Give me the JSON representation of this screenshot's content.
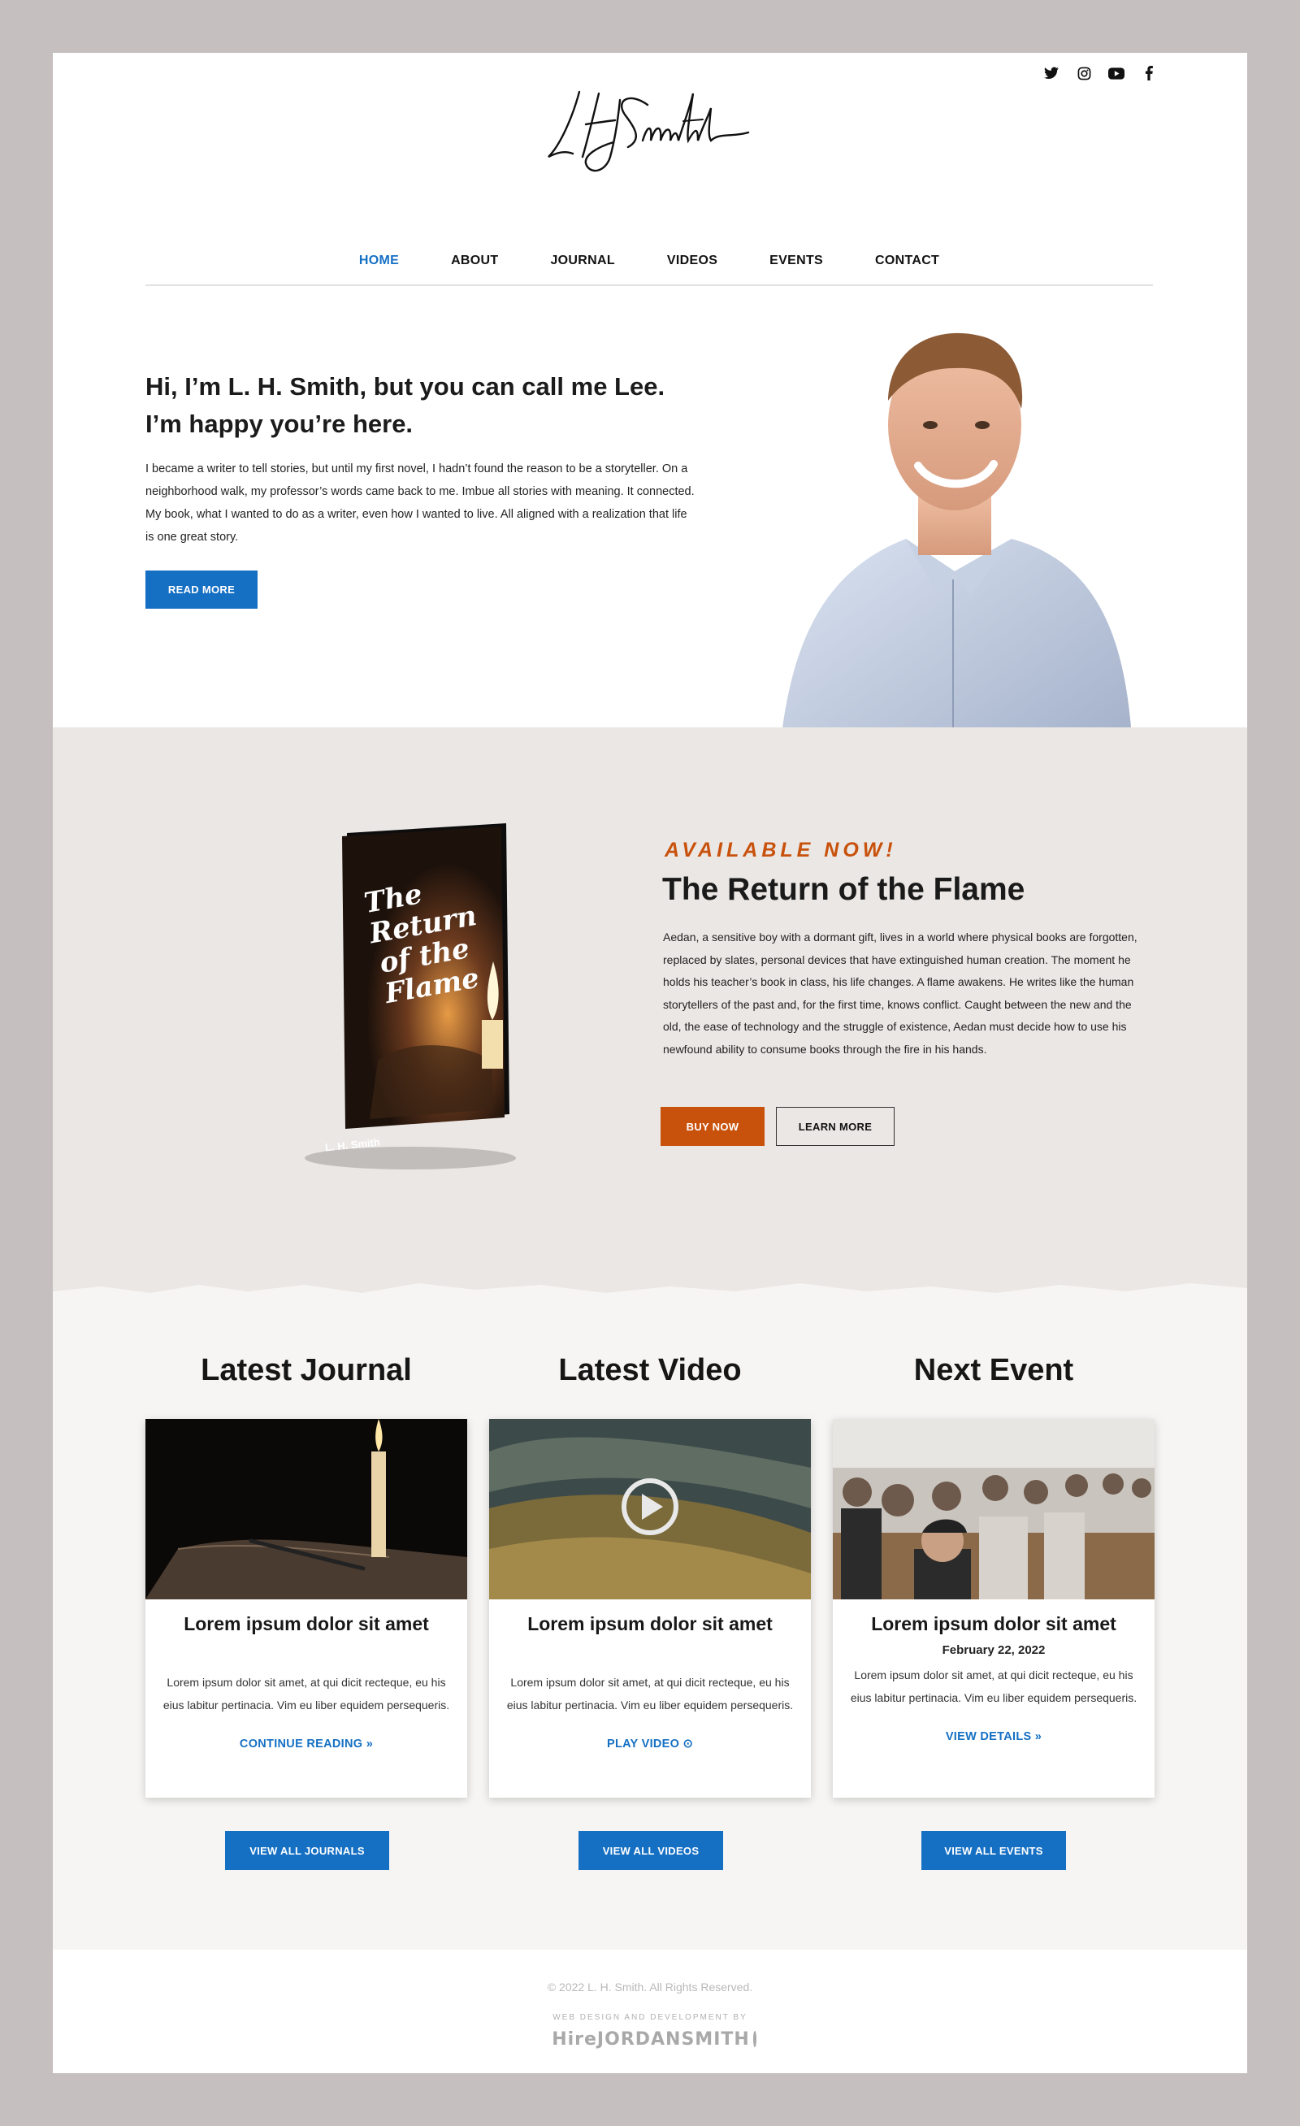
{
  "header": {
    "social": [
      {
        "icon": "twitter-icon"
      },
      {
        "icon": "instagram-icon"
      },
      {
        "icon": "youtube-icon"
      },
      {
        "icon": "facebook-icon"
      }
    ],
    "logo_text": "LHSmith"
  },
  "nav": {
    "items": [
      {
        "label": "HOME",
        "active": true
      },
      {
        "label": "ABOUT"
      },
      {
        "label": "JOURNAL"
      },
      {
        "label": "VIDEOS"
      },
      {
        "label": "EVENTS"
      },
      {
        "label": "CONTACT"
      }
    ]
  },
  "hero": {
    "title_line1": "Hi, I’m L. H. Smith, but you can call me Lee.",
    "title_line2": "I’m happy you’re here.",
    "body": "I became a writer to tell stories, but until my first novel, I hadn’t found the reason to be a storyteller. On a neighborhood walk, my professor’s words came back to me. Imbue all stories with meaning. It connected. My book, what I wanted to do as a writer, even how I wanted to live. All aligned with a realization that life is one great story.",
    "button": "READ MORE"
  },
  "book": {
    "cover_title_line1": "The Return",
    "cover_title_line2": "of the Flame",
    "cover_author": "L. H. Smith",
    "tagline": "AVAILABLE NOW!",
    "title": "The Return of the Flame",
    "description": "Aedan, a sensitive boy with a dormant gift, lives in a world where physical books are forgotten, replaced by slates, personal devices that have extinguished human creation. The moment he holds his teacher’s book in class, his life changes. A flame awakens. He writes like the human storytellers of the past and, for the first time, knows conflict. Caught between the new and the old, the ease of technology and the struggle of existence, Aedan must decide how to use his newfound ability to consume books through the fire in his hands.",
    "buy_button": "BUY NOW",
    "learn_button": "LEARN MORE"
  },
  "columns": [
    {
      "heading": "Latest Journal",
      "card_title": "Lorem ipsum dolor sit amet",
      "card_text": "Lorem ipsum dolor sit amet, at qui dicit recteque, eu his eius labitur pertinacia. Vim eu liber equidem persequeris.",
      "link": "CONTINUE READING",
      "link_icon": "double-chevron-right-icon",
      "button": "VIEW ALL JOURNALS"
    },
    {
      "heading": "Latest Video",
      "card_title": "Lorem ipsum dolor sit amet",
      "card_text": "Lorem ipsum dolor sit amet, at qui dicit recteque, eu his eius labitur pertinacia. Vim eu liber equidem persequeris.",
      "link": "PLAY VIDEO",
      "link_icon": "play-circle-icon",
      "button": "VIEW ALL VIDEOS"
    },
    {
      "heading": "Next Event",
      "card_title": "Lorem ipsum dolor sit amet",
      "card_date": "February 22, 2022",
      "card_text": "Lorem ipsum dolor sit amet, at qui dicit recteque, eu his eius labitur pertinacia. Vim eu liber equidem persequeris.",
      "link": "VIEW DETAILS",
      "link_icon": "double-chevron-right-icon",
      "button": "VIEW ALL EVENTS"
    }
  ],
  "footer": {
    "copyright": "© 2022 L. H. Smith. All Rights Reserved.",
    "credit_label": "WEB DESIGN AND DEVELOPMENT BY",
    "credit_name": "HireJORDANSMITH"
  },
  "colors": {
    "accent_blue": "#1570c4",
    "accent_orange": "#c8510c",
    "paper": "#ebe7e4",
    "page_bg": "#c6bfbf"
  }
}
